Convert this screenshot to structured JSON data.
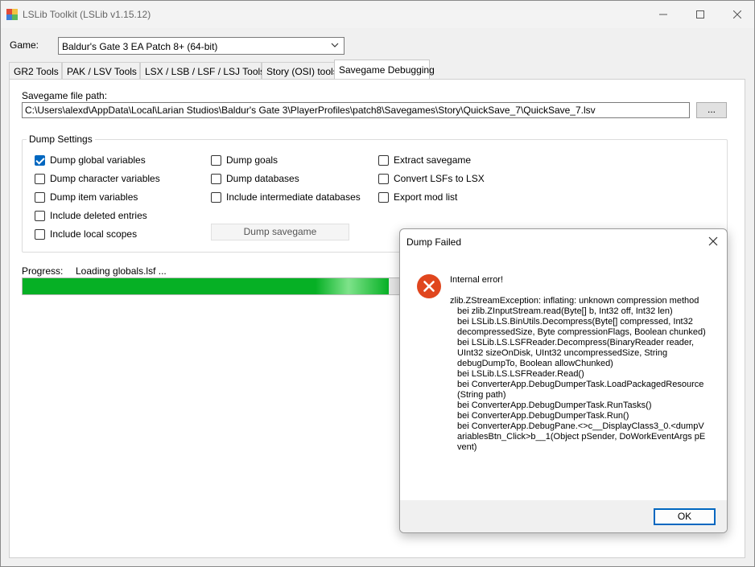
{
  "window": {
    "title": "LSLib Toolkit (LSLib v1.15.12)"
  },
  "game": {
    "label": "Game:",
    "selected": "Baldur's Gate 3 EA Patch 8+ (64-bit)"
  },
  "tabs": [
    "GR2 Tools",
    "PAK / LSV Tools",
    "LSX / LSB / LSF / LSJ Tools",
    "Story (OSI) tools",
    "Savegame Debugging"
  ],
  "savegame": {
    "path_label": "Savegame file path:",
    "path_value": "C:\\Users\\alexd\\AppData\\Local\\Larian Studios\\Baldur's Gate 3\\PlayerProfiles\\patch8\\Savegames\\Story\\QuickSave_7\\QuickSave_7.lsv",
    "browse_label": "..."
  },
  "dump_settings": {
    "title": "Dump Settings",
    "col1": [
      {
        "label": "Dump global variables",
        "checked": true
      },
      {
        "label": "Dump character variables",
        "checked": false
      },
      {
        "label": "Dump item variables",
        "checked": false
      },
      {
        "label": "Include deleted entries",
        "checked": false
      },
      {
        "label": "Include local scopes",
        "checked": false
      }
    ],
    "col2": [
      {
        "label": "Dump goals",
        "checked": false
      },
      {
        "label": "Dump databases",
        "checked": false
      },
      {
        "label": "Include intermediate databases",
        "checked": false
      }
    ],
    "col3": [
      {
        "label": "Extract savegame",
        "checked": false
      },
      {
        "label": "Convert LSFs to LSX",
        "checked": false
      },
      {
        "label": "Export mod list",
        "checked": false
      }
    ],
    "dump_button": "Dump savegame"
  },
  "progress": {
    "label": "Progress:",
    "status": "Loading globals.lsf ...",
    "fraction": 0.52,
    "color": "#06b025"
  },
  "dialog": {
    "title": "Dump Failed",
    "heading": "Internal error!",
    "lines": [
      "zlib.ZStreamException: inflating: unknown compression method",
      "bei zlib.ZInputStream.read(Byte[] b, Int32 off, Int32 len)",
      "bei LSLib.LS.BinUtils.Decompress(Byte[] compressed, Int32 decompressedSize, Byte compressionFlags, Boolean chunked)",
      "bei LSLib.LS.LSFReader.Decompress(BinaryReader reader, UInt32 sizeOnDisk, UInt32 uncompressedSize, String debugDumpTo, Boolean allowChunked)",
      "bei LSLib.LS.LSFReader.Read()",
      "bei ConverterApp.DebugDumperTask.LoadPackagedResource(String path)",
      "bei ConverterApp.DebugDumperTask.RunTasks()",
      "bei ConverterApp.DebugDumperTask.Run()",
      "bei ConverterApp.DebugPane.<>c__DisplayClass3_0.<dumpVariablesBtn_Click>b__1(Object pSender, DoWorkEventArgs pEvent)"
    ],
    "ok_label": "OK",
    "error_color": "#e0461e"
  }
}
